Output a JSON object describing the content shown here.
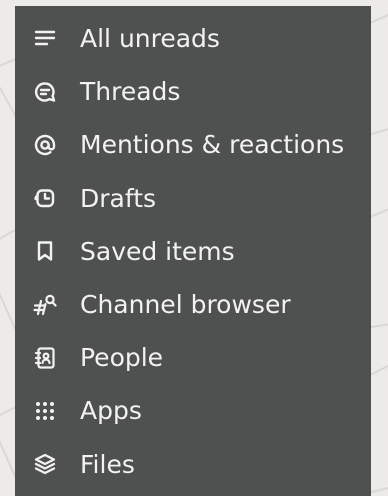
{
  "sidebar": {
    "items": [
      {
        "label": "All unreads",
        "icon": "lines-icon"
      },
      {
        "label": "Threads",
        "icon": "thread-bubble-icon"
      },
      {
        "label": "Mentions & reactions",
        "icon": "at-sign-icon"
      },
      {
        "label": "Drafts",
        "icon": "drafts-icon"
      },
      {
        "label": "Saved items",
        "icon": "bookmark-icon"
      },
      {
        "label": "Channel browser",
        "icon": "channel-search-icon"
      },
      {
        "label": "People",
        "icon": "contacts-book-icon"
      },
      {
        "label": "Apps",
        "icon": "grid-dots-icon"
      },
      {
        "label": "Files",
        "icon": "layers-icon"
      }
    ]
  },
  "colors": {
    "sidebar_bg": "#4f5150",
    "text": "#f2f2f2",
    "backdrop": "#ecebe9"
  }
}
